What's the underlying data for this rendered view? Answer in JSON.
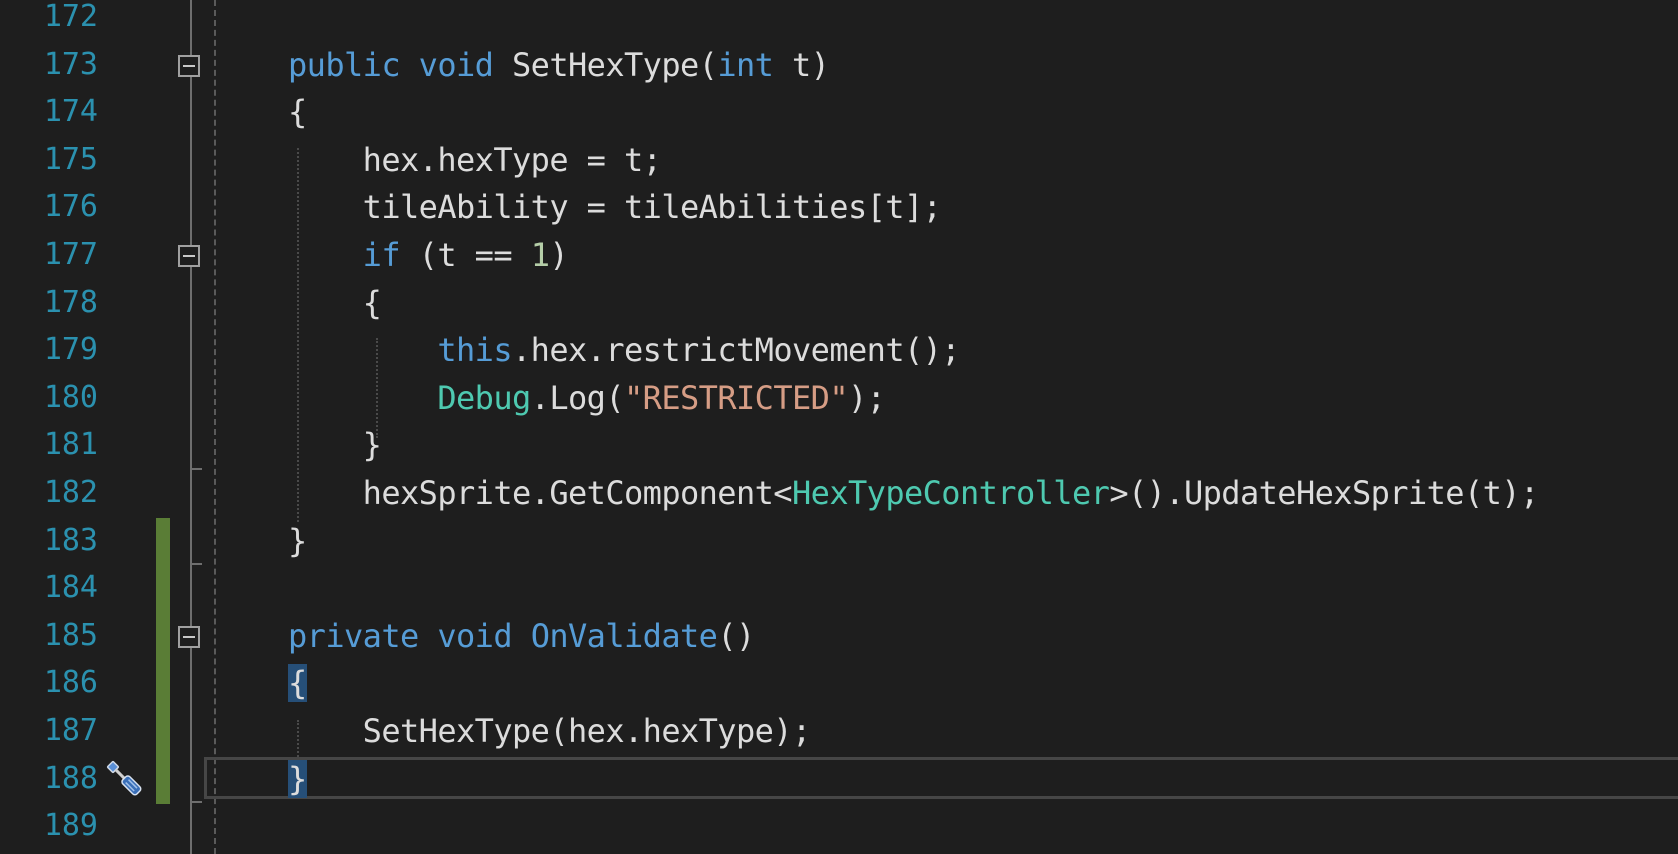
{
  "lines": [
    {
      "n": "172",
      "tokens": []
    },
    {
      "n": "173",
      "tokens": [
        {
          "t": "public",
          "c": "kw"
        },
        {
          "t": " "
        },
        {
          "t": "void",
          "c": "kw"
        },
        {
          "t": " SetHexType("
        },
        {
          "t": "int",
          "c": "kw"
        },
        {
          "t": " t)"
        }
      ]
    },
    {
      "n": "174",
      "tokens": [
        {
          "t": "{"
        }
      ]
    },
    {
      "n": "175",
      "tokens": [
        {
          "t": "    hex.hexType = t;"
        }
      ]
    },
    {
      "n": "176",
      "tokens": [
        {
          "t": "    tileAbility = tileAbilities[t];"
        }
      ]
    },
    {
      "n": "177",
      "tokens": [
        {
          "t": "    "
        },
        {
          "t": "if",
          "c": "kw"
        },
        {
          "t": " (t == "
        },
        {
          "t": "1",
          "c": "nu"
        },
        {
          "t": ")"
        }
      ]
    },
    {
      "n": "178",
      "tokens": [
        {
          "t": "    {"
        }
      ]
    },
    {
      "n": "179",
      "tokens": [
        {
          "t": "        "
        },
        {
          "t": "this",
          "c": "kw"
        },
        {
          "t": ".hex.restrictMovement();"
        }
      ]
    },
    {
      "n": "180",
      "tokens": [
        {
          "t": "        "
        },
        {
          "t": "Debug",
          "c": "ty"
        },
        {
          "t": ".Log("
        },
        {
          "t": "\"RESTRICTED\"",
          "c": "st"
        },
        {
          "t": ");"
        }
      ]
    },
    {
      "n": "181",
      "tokens": [
        {
          "t": "    }"
        }
      ]
    },
    {
      "n": "182",
      "tokens": [
        {
          "t": "    hexSprite.GetComponent<"
        },
        {
          "t": "HexTypeController",
          "c": "ty"
        },
        {
          "t": ">().UpdateHexSprite(t);"
        }
      ]
    },
    {
      "n": "183",
      "tokens": [
        {
          "t": "}"
        }
      ]
    },
    {
      "n": "184",
      "tokens": []
    },
    {
      "n": "185",
      "tokens": [
        {
          "t": "private",
          "c": "kw"
        },
        {
          "t": " "
        },
        {
          "t": "void",
          "c": "kw"
        },
        {
          "t": " "
        },
        {
          "t": "OnValidate",
          "c": "kw"
        },
        {
          "t": "()"
        }
      ]
    },
    {
      "n": "186",
      "tokens": [
        {
          "t": "{",
          "c": "brace-hl"
        }
      ]
    },
    {
      "n": "187",
      "tokens": [
        {
          "t": "    SetHexType(hex.hexType);"
        }
      ]
    },
    {
      "n": "188",
      "tokens": [
        {
          "t": "}",
          "c": "brace-hl"
        }
      ]
    },
    {
      "n": "189",
      "tokens": []
    }
  ],
  "icons": {
    "quick_actions": "screwdriver-icon",
    "fold": "collapse-minus-icon"
  },
  "colors": {
    "background": "#1e1e1e",
    "line_number": "#2b91af",
    "keyword": "#569cd6",
    "type": "#4ec9b0",
    "string": "#d69d85",
    "number": "#b5cea8",
    "text": "#dcdcdc",
    "change_marker": "#5a7d36",
    "brace_highlight": "#264f78"
  }
}
